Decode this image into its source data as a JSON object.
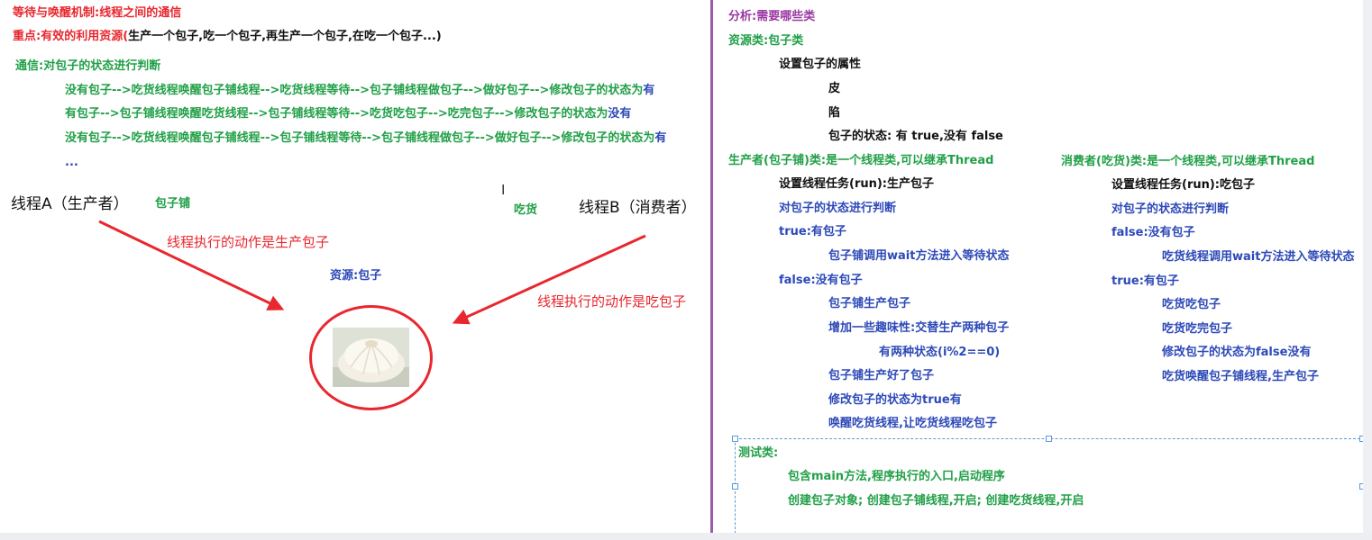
{
  "left": {
    "title": "等待与唤醒机制:线程之间的通信",
    "key_point_prefix": "重点:有效的利用资源(",
    "key_point_rest": "生产一个包子,吃一个包子,再生产一个包子,在吃一个包子...)",
    "comm_heading": "通信:对包子的状态进行判断",
    "flow1_main": "没有包子-->吃货线程唤醒包子铺线程-->吃货线程等待-->包子铺线程做包子-->做好包子-->修改包子的状态为",
    "flow1_end": "有",
    "flow2_main": "有包子-->包子铺线程唤醒吃货线程-->包子铺线程等待-->吃货吃包子-->吃完包子-->修改包子的状态为",
    "flow2_end": "没有",
    "flow3_main": "没有包子-->吃货线程唤醒包子铺线程-->包子铺线程等待-->包子铺线程做包子-->做好包子-->修改包子的状态为",
    "flow3_end": "有",
    "ellipsis": "...",
    "thread_a": "线程A（生产者）",
    "bun_shop": "包子铺",
    "foodie": "吃货",
    "thread_b": "线程B（消费者）",
    "action_produce": "线程执行的动作是生产包子",
    "resource": "资源:包子",
    "action_eat": "线程执行的动作是吃包子"
  },
  "right": {
    "analysis": "分析:需要哪些类",
    "resource_class": "资源类:包子类",
    "set_props": "设置包子的属性",
    "skin": "皮",
    "filling": "陷",
    "state_prefix": "包子的状态: 有 ",
    "state_true": "true",
    "state_mid": ",没有 ",
    "state_false": "false",
    "producer_heading": "生产者(包子铺)类:是一个线程类,可以继承Thread",
    "producer_task": "设置线程任务(run):生产包子",
    "producer_judge": "对包子的状态进行判断",
    "producer_true": "true:有包子",
    "producer_wait": "包子铺调用wait方法进入等待状态",
    "producer_false": "false:没有包子",
    "producer_make": "包子铺生产包子",
    "producer_fun": "增加一些趣味性:交替生产两种包子",
    "producer_two_states": "有两种状态(i%2==0)",
    "producer_done": "包子铺生产好了包子",
    "producer_set_true": "修改包子的状态为true有",
    "producer_wake": "唤醒吃货线程,让吃货线程吃包子",
    "consumer_heading": "消费者(吃货)类:是一个线程类,可以继承Thread",
    "consumer_task": "设置线程任务(run):吃包子",
    "consumer_judge": "对包子的状态进行判断",
    "consumer_false": "false:没有包子",
    "consumer_wait": "吃货线程调用wait方法进入等待状态",
    "consumer_true": "true:有包子",
    "consumer_eat": "吃货吃包子",
    "consumer_done": "吃货吃完包子",
    "consumer_set_false": "修改包子的状态为false没有",
    "consumer_wake": "吃货唤醒包子铺线程,生产包子",
    "test_heading": "测试类:",
    "test_main": "包含main方法,程序执行的入口,启动程序",
    "test_create": "创建包子对象; 创建包子铺线程,开启; 创建吃货线程,开启"
  },
  "colors": {
    "red": "#e8272e",
    "green": "#21a048",
    "blue": "#2d49b8",
    "purple": "#9b3aa3",
    "divider": "#9d5aa8"
  }
}
